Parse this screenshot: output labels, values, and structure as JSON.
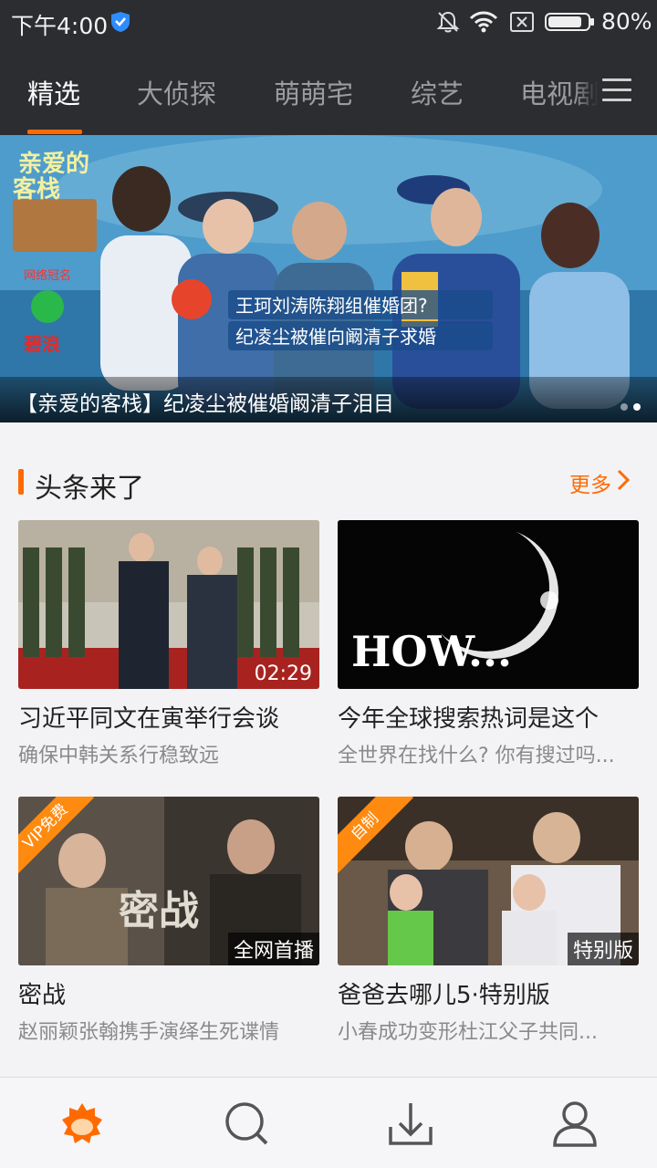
{
  "status_bar": {
    "time": "下午4:00",
    "battery_percent": "80%"
  },
  "top_nav": {
    "tabs": [
      {
        "label": "精选",
        "active": true
      },
      {
        "label": "大侦探",
        "active": false
      },
      {
        "label": "萌萌宅",
        "active": false
      },
      {
        "label": "综艺",
        "active": false
      },
      {
        "label": "电视剧",
        "active": false
      }
    ],
    "accent_color": "#ff6a00"
  },
  "banner": {
    "caption": "【亲爱的客栈】纪凌尘被催婚阚清子泪目",
    "show_title_art": "亲爱的客栈",
    "sponsor_label": "网络冠名",
    "sponsor_brand": "碧浪",
    "overlay_text_line1": "王珂刘涛陈翔组催婚团?",
    "overlay_text_line2": "纪凌尘被催向阚清子求婚"
  },
  "section": {
    "title": "头条来了",
    "more_label": "更多"
  },
  "cards": [
    {
      "title": "习近平同文在寅举行会谈",
      "subtitle": "确保中韩关系行稳致远",
      "duration": "02:29"
    },
    {
      "title": "今年全球搜索热词是这个",
      "subtitle": "全世界在找什么? 你有搜过吗...",
      "thumb_text": "HOW..."
    },
    {
      "title": "密战",
      "subtitle": "赵丽颖张翰携手演绎生死谍情",
      "badge": "全网首播",
      "ribbon": "VIP免费",
      "thumb_text": "密战"
    },
    {
      "title": "爸爸去哪儿5·特别版",
      "subtitle": "小春成功变形杜江父子共同...",
      "badge": "特别版",
      "ribbon": "自制"
    }
  ],
  "bottom_nav": {
    "items": [
      "home-icon",
      "search-icon",
      "download-icon",
      "profile-icon"
    ]
  }
}
